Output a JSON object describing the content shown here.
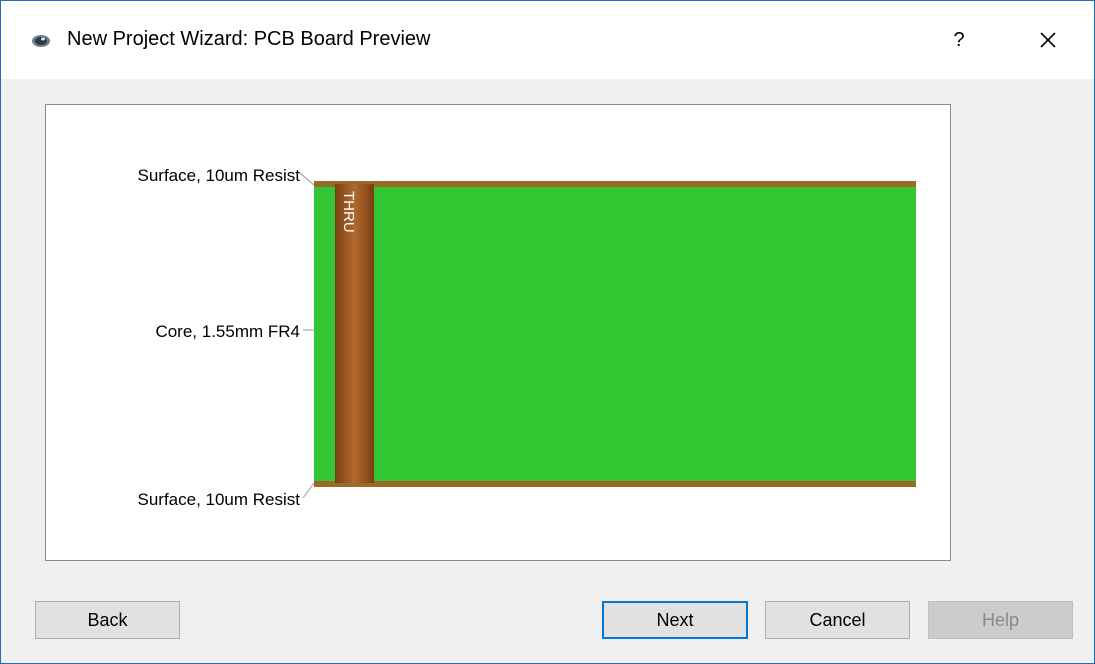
{
  "window": {
    "title": "New Project Wizard: PCB Board Preview",
    "help_label": "?"
  },
  "stackup": {
    "layers": [
      {
        "label": "Surface, 10um Resist"
      },
      {
        "label": "Core, 1.55mm FR4"
      },
      {
        "label": "Surface, 10um Resist"
      }
    ],
    "via_label": "THRU",
    "colors": {
      "core": "#33c633",
      "copper": "#9a6a2a",
      "via_dark": "#7a3e14",
      "via_light": "#b26a30",
      "leader_line": "#9a9a9a"
    }
  },
  "buttons": {
    "back": "Back",
    "next": "Next",
    "cancel": "Cancel",
    "help": "Help"
  }
}
